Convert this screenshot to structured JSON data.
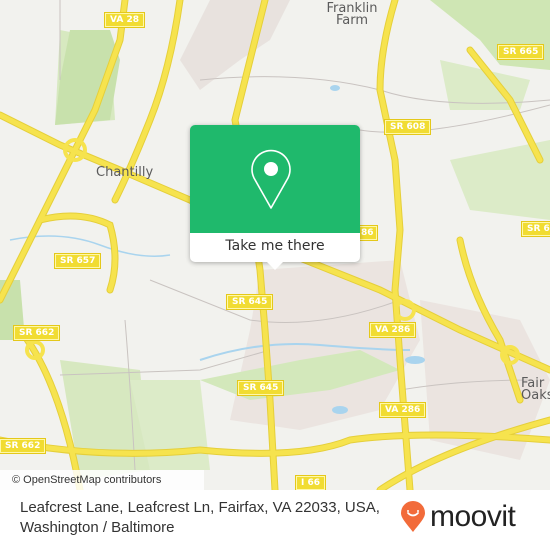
{
  "map": {
    "place_labels": [
      {
        "id": "chantilly",
        "text": "Chantilly"
      },
      {
        "id": "franklin-farm",
        "text": "Franklin Farm"
      },
      {
        "id": "fair-oaks",
        "text": "Fair Oaks"
      }
    ],
    "road_shields": [
      {
        "id": "va-28",
        "text": "VA 28"
      },
      {
        "id": "sr-665",
        "text": "SR 665"
      },
      {
        "id": "sr-608",
        "text": "SR 608"
      },
      {
        "id": "sr-286-partial",
        "text": "86"
      },
      {
        "id": "sr-6xx-right",
        "text": "SR 6"
      },
      {
        "id": "sr-657",
        "text": "SR 657"
      },
      {
        "id": "sr-645-upper",
        "text": "SR 645"
      },
      {
        "id": "sr-662-upper",
        "text": "SR 662"
      },
      {
        "id": "va-286-upper",
        "text": "VA 286"
      },
      {
        "id": "sr-645-lower",
        "text": "SR 645"
      },
      {
        "id": "va-286-lower",
        "text": "VA 286"
      },
      {
        "id": "sr-662-lower",
        "text": "SR 662"
      },
      {
        "id": "i-66",
        "text": "I 66"
      }
    ],
    "colors": {
      "road": "#f6e34e",
      "road_edge": "#e5cf3a",
      "park": "#cfe6b4",
      "water": "#a9d4ee",
      "urban": "#e8e2de",
      "background": "#f2f2ee"
    },
    "attribution": "© OpenStreetMap contributors"
  },
  "popup": {
    "icon": "location-pin-icon",
    "action_label": "Take me there",
    "accent_color": "#1fb96c"
  },
  "footer": {
    "address_line1": "Leafcrest Lane, Leafcrest Ln, Fairfax, VA 22033, USA,",
    "address_line2": "Washington / Baltimore",
    "brand": "moovit",
    "brand_color": "#f26b3a"
  }
}
